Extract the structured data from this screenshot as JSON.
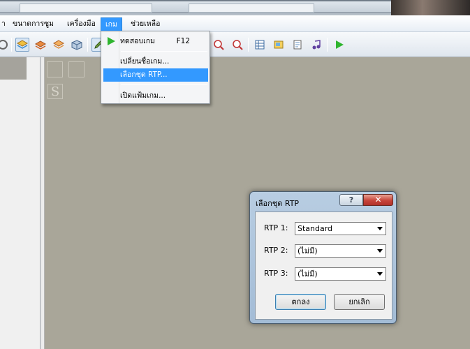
{
  "menubar": {
    "items": [
      {
        "label": "า"
      },
      {
        "label": "ขนาดการซูม"
      },
      {
        "label": "เครื่องมือ"
      },
      {
        "label": "เกม"
      },
      {
        "label": "ช่วยเหลือ"
      }
    ]
  },
  "toolbar": {
    "icons": [
      "help-icon",
      "layer-1-icon",
      "layer-2-icon",
      "layer-3-icon",
      "event-layer-icon",
      "pencil-icon",
      "zoom-1-icon",
      "zoom-2-icon",
      "database-icon",
      "material-icon",
      "script-icon",
      "sound-icon",
      "playtest-icon"
    ]
  },
  "dropdown": {
    "items": [
      {
        "label": "ทดสอบเกม",
        "shortcut": "F12"
      },
      {
        "label": "เปลี่ยนชื่อเกม..."
      },
      {
        "label": "เลือกชุด RTP..."
      },
      {
        "label": "เปิดแฟ้มเกม..."
      }
    ]
  },
  "dialog": {
    "title": "เลือกชุด RTP",
    "help": "?",
    "close": "✕",
    "rows": [
      {
        "label": "RTP 1:",
        "value": "Standard"
      },
      {
        "label": "RTP 2:",
        "value": "(ไม่มี)"
      },
      {
        "label": "RTP 3:",
        "value": "(ไม่มี)"
      }
    ],
    "ok": "ตกลง",
    "cancel": "ยกเลิก"
  },
  "canvas": {
    "tile_letter": "S"
  },
  "colors": {
    "accent": "#3399ff",
    "canvas": "#a9a699",
    "play": "#2fb52f"
  }
}
